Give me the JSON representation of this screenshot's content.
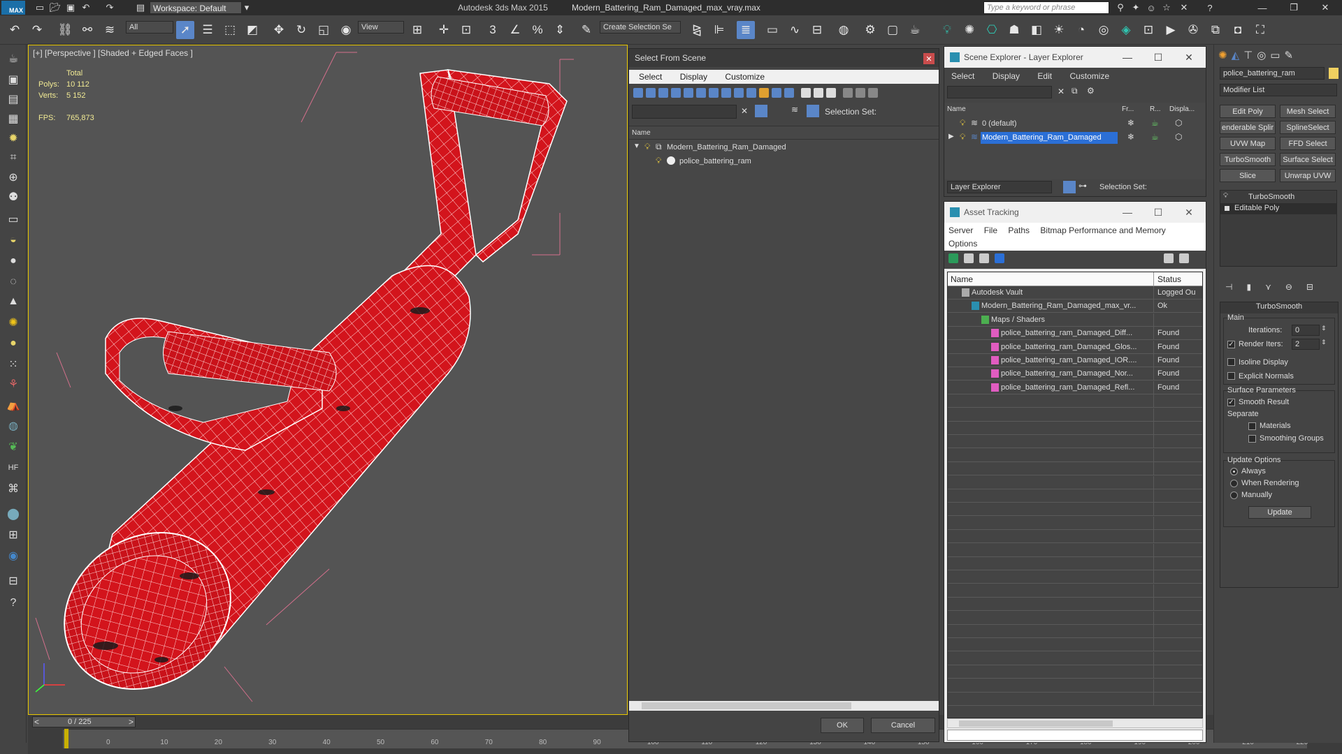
{
  "app": {
    "title": "Autodesk 3ds Max  2015",
    "file": "Modern_Battering_Ram_Damaged_max_vray.max",
    "logo": "MAX",
    "workspace": "Workspace: Default",
    "search_placeholder": "Type a keyword or phrase"
  },
  "toolbar": {
    "selection_filter": "All",
    "ref_coord": "View",
    "named_selection": "Create Selection Se",
    "icons": [
      "undo-icon",
      "redo-icon",
      "link-icon",
      "unlink-icon",
      "bind-spacewarp-icon",
      "select-icon",
      "select-by-name-icon",
      "rect-region-icon",
      "window-crossing-icon",
      "move-icon",
      "rotate-icon",
      "scale-icon",
      "pivot-icon",
      "mirror-icon",
      "align-icon",
      "layer-explorer-icon",
      "material-editor-icon",
      "render-setup-icon",
      "render-icon"
    ]
  },
  "viewport": {
    "label": "[+] [Perspective ] [Shaded + Edged Faces ]",
    "stats": {
      "total_label": "Total",
      "polys_label": "Polys:",
      "polys_value": "10 112",
      "verts_label": "Verts:",
      "verts_value": "5 152",
      "fps_label": "FPS:",
      "fps_value": "765,873"
    }
  },
  "timeline": {
    "frame": "0 / 225",
    "ticks": [
      "0",
      "10",
      "20",
      "30",
      "40",
      "50",
      "60",
      "70",
      "80",
      "90",
      "100",
      "110",
      "120",
      "130",
      "140",
      "150",
      "160",
      "170",
      "180",
      "190",
      "200",
      "210",
      "220"
    ]
  },
  "select_from_scene": {
    "title": "Select From Scene",
    "menu": [
      "Select",
      "Display",
      "Customize"
    ],
    "selection_set_label": "Selection Set:",
    "column_name": "Name",
    "items": [
      {
        "name": "Modern_Battering_Ram_Damaged",
        "level": 0
      },
      {
        "name": "police_battering_ram",
        "level": 1
      }
    ],
    "ok": "OK",
    "cancel": "Cancel"
  },
  "scene_explorer": {
    "title": "Scene Explorer - Layer Explorer",
    "menu": [
      "Select",
      "Display",
      "Edit",
      "Customize"
    ],
    "columns": [
      "Name",
      "Fr...",
      "R...",
      "Displa..."
    ],
    "rows": [
      {
        "name": "0 (default)",
        "selected": false
      },
      {
        "name": "Modern_Battering_Ram_Damaged",
        "selected": true
      }
    ],
    "footer_dropdown": "Layer Explorer",
    "selection_set_label": "Selection Set:"
  },
  "asset_tracking": {
    "title": "Asset Tracking",
    "menu": [
      "Server",
      "File",
      "Paths",
      "Bitmap Performance and Memory"
    ],
    "menu2": "Options",
    "columns": [
      "Name",
      "Status"
    ],
    "rows": [
      {
        "name": "Autodesk Vault",
        "status": "Logged Ou",
        "level": 0
      },
      {
        "name": "Modern_Battering_Ram_Damaged_max_vr...",
        "status": "Ok",
        "level": 1
      },
      {
        "name": "Maps / Shaders",
        "status": "",
        "level": 2
      },
      {
        "name": "police_battering_ram_Damaged_Diff...",
        "status": "Found",
        "level": 3
      },
      {
        "name": "police_battering_ram_Damaged_Glos...",
        "status": "Found",
        "level": 3
      },
      {
        "name": "police_battering_ram_Damaged_IOR....",
        "status": "Found",
        "level": 3
      },
      {
        "name": "police_battering_ram_Damaged_Nor...",
        "status": "Found",
        "level": 3
      },
      {
        "name": "police_battering_ram_Damaged_Refl...",
        "status": "Found",
        "level": 3
      }
    ]
  },
  "command_panel": {
    "object_name": "police_battering_ram",
    "modifier_list": "Modifier List",
    "modifier_buttons": [
      "Edit Poly",
      "Mesh Select",
      "enderable Splir",
      "SplineSelect",
      "UVW Map",
      "FFD Select",
      "TurboSmooth",
      "Surface Select",
      "Slice",
      "Unwrap UVW"
    ],
    "stack": [
      "TurboSmooth",
      "Editable Poly"
    ],
    "rollout_title": "TurboSmooth",
    "main_label": "Main",
    "iterations_label": "Iterations:",
    "iterations_value": "0",
    "render_iters_label": "Render Iters:",
    "render_iters_value": "2",
    "isoline_label": "Isoline Display",
    "explicit_normals_label": "Explicit Normals",
    "surface_params_label": "Surface Parameters",
    "smooth_result_label": "Smooth Result",
    "separate_label": "Separate",
    "materials_label": "Materials",
    "smoothing_groups_label": "Smoothing Groups",
    "update_options_label": "Update Options",
    "always_label": "Always",
    "when_rendering_label": "When Rendering",
    "manually_label": "Manually",
    "update_button": "Update"
  },
  "colors": {
    "accent": "#2b6fd6",
    "ram_red": "#d3141c",
    "viewport_border": "#e8c700",
    "stats_text": "#f1ea94"
  }
}
